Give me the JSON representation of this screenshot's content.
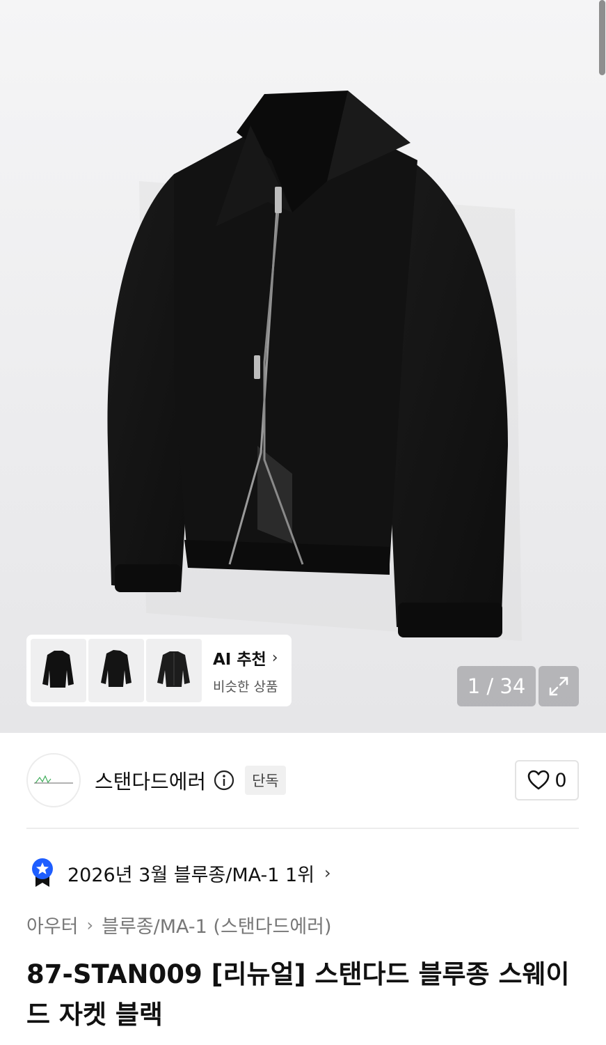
{
  "gallery": {
    "counter": "1 / 34",
    "thumbnails": [
      "thumbnail-front",
      "thumbnail-side",
      "thumbnail-dark"
    ],
    "ai_title": "AI 추천",
    "ai_subtitle": "비슷한 상품"
  },
  "brand": {
    "name": "스탠다드에러",
    "badge": "단독",
    "like_count": "0"
  },
  "ranking": {
    "text": "2026년 3월 블루종/MA-1 1위"
  },
  "breadcrumb": {
    "category": "아우터",
    "subcategory": "블루종/MA-1 (스탠다드에러)"
  },
  "product": {
    "title": "87-STAN009 [리뉴얼] 스탠다드 블루종 스웨이드 자켓 블랙"
  },
  "colors": {
    "rank_badge": "#1e5eff",
    "jacket": "#141414"
  }
}
